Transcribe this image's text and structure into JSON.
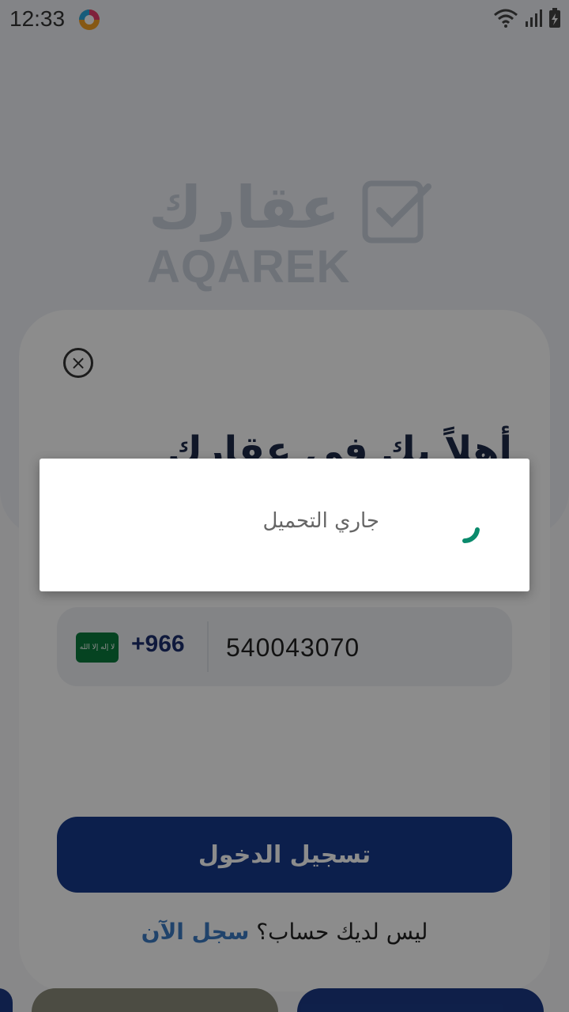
{
  "status_bar": {
    "time": "12:33",
    "icons": [
      "wifi-icon",
      "signal-icon",
      "battery-charging-icon"
    ]
  },
  "logo": {
    "arabic": "عقارك",
    "english": "AQAREK"
  },
  "login_card": {
    "welcome_text": "أهلاً بك في عقارك",
    "country_code": "+966",
    "flag_text": "لا إله إلا الله",
    "phone_value": "540043070",
    "login_button": "تسجيل الدخول",
    "signup_question": "ليس لديك حساب؟",
    "signup_link": "سجل الآن"
  },
  "loading_dialog": {
    "message": "جاري التحميل"
  },
  "colors": {
    "primary": "#163a8a",
    "link": "#3b7bc3",
    "spinner": "#0a8a6c",
    "flag": "#0a7a3c"
  }
}
